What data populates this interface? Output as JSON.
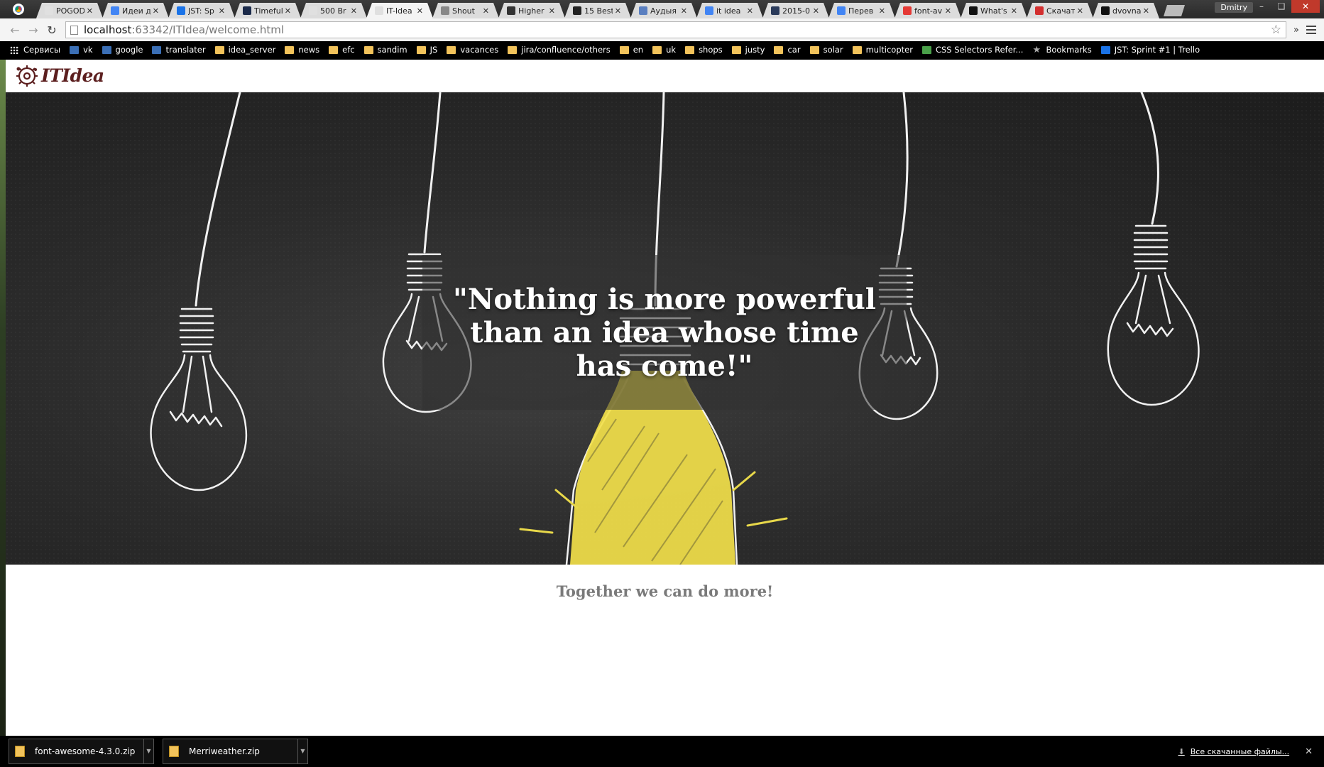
{
  "browser": {
    "tabs": [
      {
        "title": "POGOD",
        "icon": "blank-page-icon",
        "color": "#e0e0e0"
      },
      {
        "title": "Идеи д",
        "icon": "google-docs-icon",
        "color": "#4285f4"
      },
      {
        "title": "JST: Sp",
        "icon": "trello-icon",
        "color": "#1a73e8"
      },
      {
        "title": "Timeful",
        "icon": "timeful-icon",
        "color": "#1b2a4a"
      },
      {
        "title": "500 Br",
        "icon": "blank-page-icon",
        "color": "#e0e0e0"
      },
      {
        "title": "IT-Idea",
        "icon": "blank-page-icon",
        "color": "#e0e0e0"
      },
      {
        "title": "Shout",
        "icon": "shout-icon",
        "color": "#888888"
      },
      {
        "title": "Higher",
        "icon": "higher-icon",
        "color": "#333333"
      },
      {
        "title": "15 Best",
        "icon": "bootstrap-icon",
        "color": "#222222"
      },
      {
        "title": "Аудыя",
        "icon": "audio-icon",
        "color": "#5a7fc0"
      },
      {
        "title": "it idea",
        "icon": "google-search-icon",
        "color": "#4285f4"
      },
      {
        "title": "2015-0",
        "icon": "h-icon",
        "color": "#2a3a5a"
      },
      {
        "title": "Перев",
        "icon": "translate-icon",
        "color": "#4285f4"
      },
      {
        "title": "font-av",
        "icon": "yandex-icon",
        "color": "#e53935"
      },
      {
        "title": "What's",
        "icon": "chat-icon",
        "color": "#111111"
      },
      {
        "title": "Скачат",
        "icon": "font-squirrel-icon",
        "color": "#d32f2f"
      },
      {
        "title": "dvovna",
        "icon": "github-icon",
        "color": "#111111"
      }
    ],
    "active_tab": 5,
    "user": "Dmitry",
    "url_host": "localhost",
    "url_rest": ":63342/ITIdea/welcome.html",
    "bookmarks": [
      {
        "label": "Сервисы",
        "icon": "apps"
      },
      {
        "label": "vk",
        "icon": "blue"
      },
      {
        "label": "google",
        "icon": "blue"
      },
      {
        "label": "translater",
        "icon": "blue"
      },
      {
        "label": "idea_server",
        "icon": "folder"
      },
      {
        "label": "news",
        "icon": "folder"
      },
      {
        "label": "efc",
        "icon": "folder"
      },
      {
        "label": "sandim",
        "icon": "folder"
      },
      {
        "label": "JS",
        "icon": "folder"
      },
      {
        "label": "vacances",
        "icon": "folder"
      },
      {
        "label": "jira/confluence/others",
        "icon": "folder"
      },
      {
        "label": "en",
        "icon": "folder"
      },
      {
        "label": "uk",
        "icon": "folder"
      },
      {
        "label": "shops",
        "icon": "folder"
      },
      {
        "label": "justy",
        "icon": "folder"
      },
      {
        "label": "car",
        "icon": "folder"
      },
      {
        "label": "solar",
        "icon": "folder"
      },
      {
        "label": "multicopter",
        "icon": "folder"
      },
      {
        "label": "CSS Selectors Refer...",
        "icon": "green"
      },
      {
        "label": "Bookmarks",
        "icon": "star"
      },
      {
        "label": "JST: Sprint #1 | Trello",
        "icon": "trello"
      }
    ]
  },
  "site": {
    "brand": "ITIdea",
    "brand_icon": "gear-tree-icon",
    "brand_color": "#5c1f1f",
    "quote": "\"Nothing is more powerful than an idea whose time has come!\"",
    "tagline": "Together we can do more!",
    "hero_icon": "chalk-lightbulbs-illustration",
    "accent_bulb_color": "#f2e04a"
  },
  "downloads": {
    "items": [
      "font-awesome-4.3.0.zip",
      "Merriweather.zip"
    ],
    "all_label": "Все скачанные файлы..."
  }
}
